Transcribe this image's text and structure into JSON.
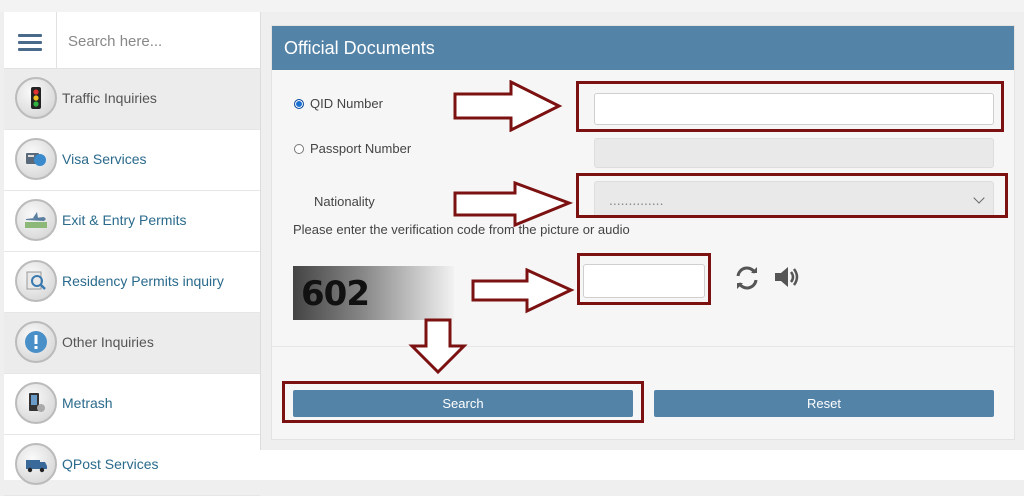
{
  "search": {
    "placeholder": "Search here..."
  },
  "sidebar": {
    "items": [
      {
        "label": "Traffic Inquiries",
        "icon": "traffic-light-icon"
      },
      {
        "label": "Visa Services",
        "icon": "visa-icon"
      },
      {
        "label": "Exit & Entry Permits",
        "icon": "airplane-icon"
      },
      {
        "label": "Residency Permits inquiry",
        "icon": "residency-search-icon"
      },
      {
        "label": "Other Inquiries",
        "icon": "exclamation-icon"
      },
      {
        "label": "Metrash",
        "icon": "metrash-icon"
      },
      {
        "label": "QPost Services",
        "icon": "qpost-van-icon"
      }
    ]
  },
  "panel": {
    "title": "Official Documents",
    "qid_label": "QID Number",
    "passport_label": "Passport Number",
    "nationality_label": "Nationality",
    "nationality_value": "..............",
    "verification_label": "Please enter the verification code from the picture or audio",
    "captcha_text": "602",
    "search_button": "Search",
    "reset_button": "Reset"
  },
  "colors": {
    "header": "#5483a8",
    "highlight": "#7c1111",
    "link": "#2a6a8c"
  }
}
